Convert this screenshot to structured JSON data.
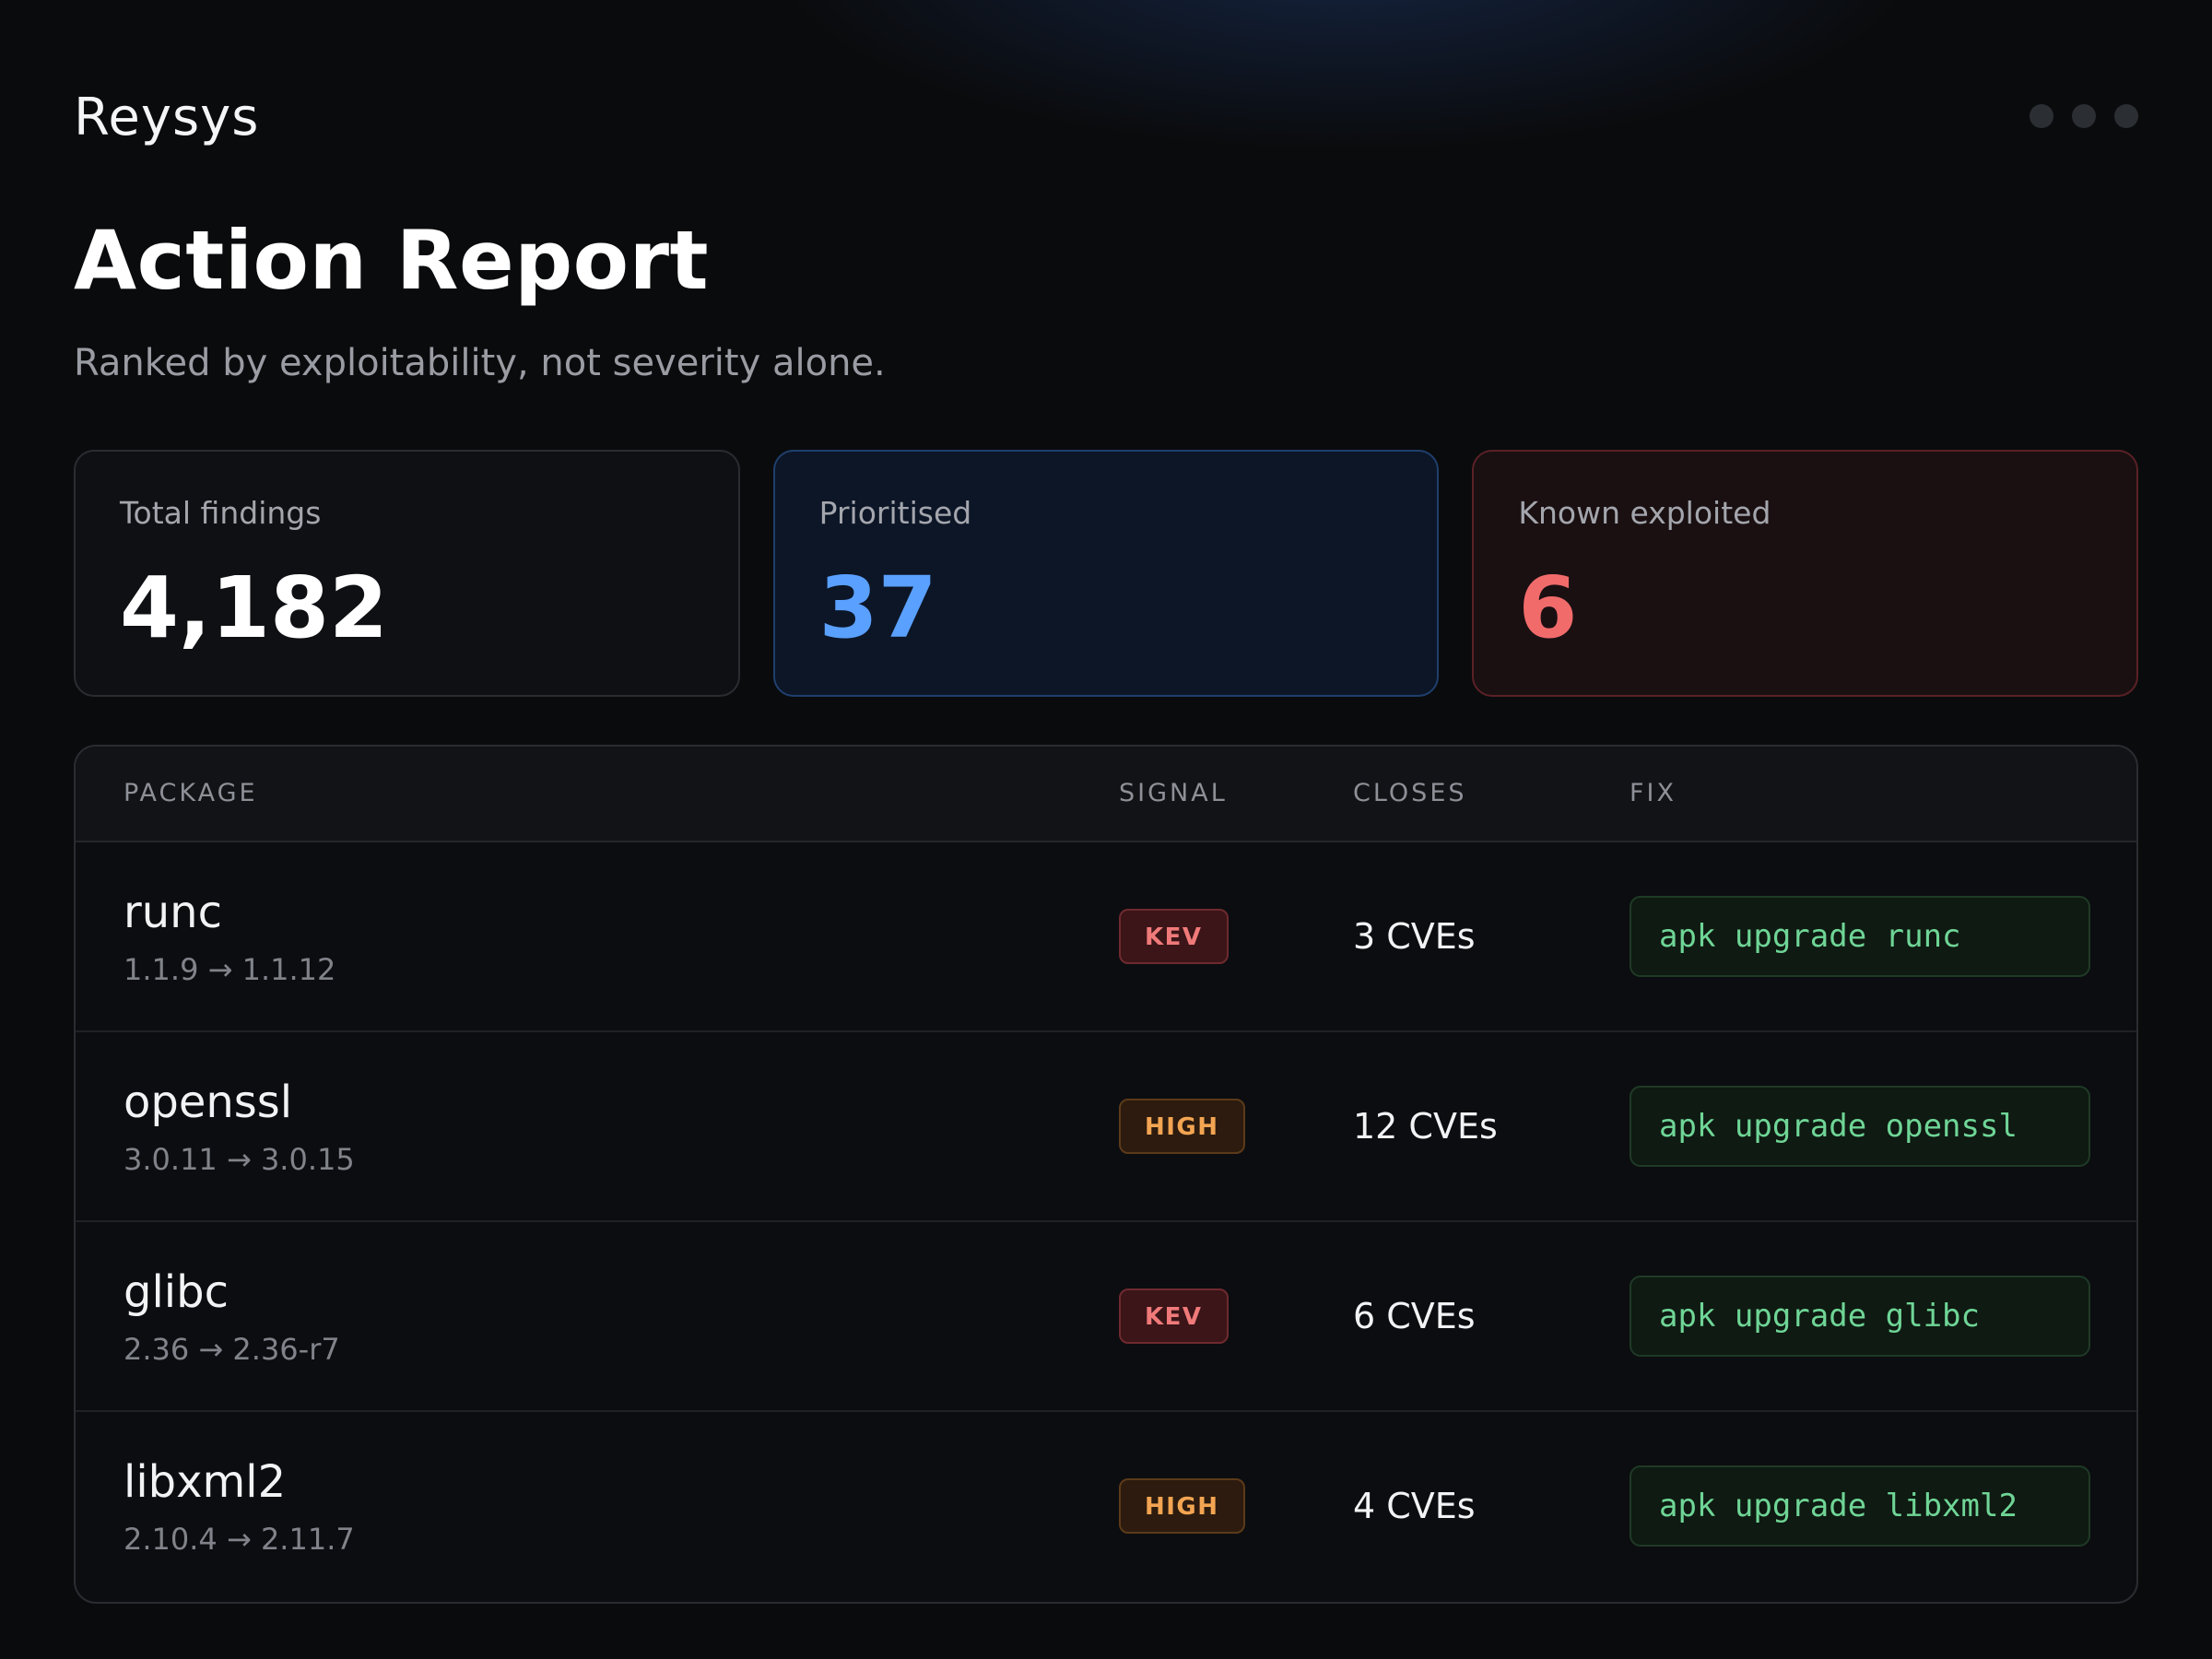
{
  "app": {
    "brand": "Reysys"
  },
  "header": {
    "menu_icon": "more-dots-icon"
  },
  "page": {
    "title": "Action Report",
    "subtitle": "Ranked by exploitability, not severity alone."
  },
  "stats": [
    {
      "label": "Total findings",
      "value": "4,182"
    },
    {
      "label": "Prioritised",
      "value": "37"
    },
    {
      "label": "Known exploited",
      "value": "6"
    }
  ],
  "table": {
    "headers": [
      "PACKAGE",
      "SIGNAL",
      "CLOSES",
      "FIX"
    ],
    "rows": [
      {
        "name": "runc",
        "version": "1.1.9 → 1.1.12",
        "signal": "KEV",
        "closes": "3 CVEs",
        "fix": "apk upgrade runc"
      },
      {
        "name": "openssl",
        "version": "3.0.11 → 3.0.15",
        "signal": "HIGH",
        "closes": "12 CVEs",
        "fix": "apk upgrade openssl"
      },
      {
        "name": "glibc",
        "version": "2.36 → 2.36-r7",
        "signal": "KEV",
        "closes": "6 CVEs",
        "fix": "apk upgrade glibc"
      },
      {
        "name": "libxml2",
        "version": "2.10.4 → 2.11.7",
        "signal": "HIGH",
        "closes": "4 CVEs",
        "fix": "apk upgrade libxml2"
      }
    ]
  },
  "colors": {
    "background": "#0a0b0d",
    "accent_blue": "#5aa0ff",
    "accent_red": "#f26b6b",
    "kev": "#f07a7a",
    "high": "#f3a552",
    "fix_text": "#6fd596"
  }
}
